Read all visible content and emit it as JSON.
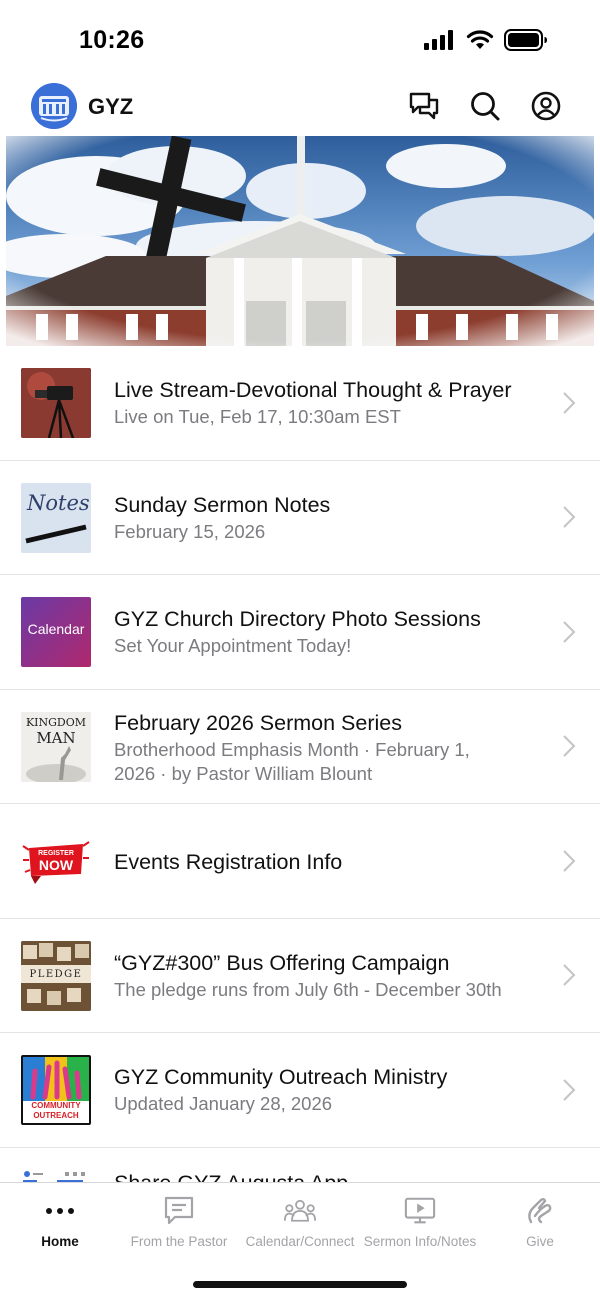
{
  "status": {
    "time": "10:26"
  },
  "header": {
    "title": "GYZ"
  },
  "list": [
    {
      "title": "Live Stream-Devotional Thought & Prayer",
      "subtitle": "Live on Tue, Feb 17, 10:30am EST",
      "thumb": "camera-thumb"
    },
    {
      "title": "Sunday Sermon Notes",
      "subtitle": "February 15, 2026",
      "thumb": "notes-thumb",
      "thumb_text": "Notes"
    },
    {
      "title": "GYZ Church Directory Photo Sessions",
      "subtitle": "Set Your Appointment Today!",
      "thumb": "calendar-thumb",
      "thumb_text": "Calendar"
    },
    {
      "title": "February 2026 Sermon Series",
      "subtitle": "Brotherhood Emphasis Month · February 1, 2026 · by Pastor William Blount",
      "thumb": "kingdom-man-thumb",
      "thumb_text_1": "KINGDOM",
      "thumb_text_2": "MAN"
    },
    {
      "title": "Events Registration Info",
      "subtitle": "",
      "thumb": "register-now-thumb",
      "thumb_text_1": "REGISTER",
      "thumb_text_2": "NOW"
    },
    {
      "title": "“GYZ#300” Bus Offering Campaign",
      "subtitle": "The pledge runs from July 6th - December 30th",
      "thumb": "pledge-thumb",
      "thumb_text": "PLEDGE"
    },
    {
      "title": "GYZ Community Outreach Ministry",
      "subtitle": "Updated January 28, 2026",
      "thumb": "outreach-thumb",
      "thumb_text_1": "COMMUNITY",
      "thumb_text_2": "OUTREACH"
    },
    {
      "title": "Share GYZ Augusta App",
      "subtitle": "",
      "thumb": "app-screens-thumb"
    }
  ],
  "tabs": [
    {
      "label": "Home",
      "icon": "more-dots-icon",
      "active": true
    },
    {
      "label": "From the Pastor",
      "icon": "message-icon",
      "active": false
    },
    {
      "label": "Calendar/Connect",
      "icon": "people-group-icon",
      "active": false
    },
    {
      "label": "Sermon Info/Notes",
      "icon": "video-screen-icon",
      "active": false
    },
    {
      "label": "Give",
      "icon": "give-icon",
      "active": false
    }
  ],
  "colors": {
    "accent": "#3b6fd8",
    "text_secondary": "#7b7b80",
    "tab_inactive": "#a3a3a8",
    "divider": "#e4e4e6"
  }
}
